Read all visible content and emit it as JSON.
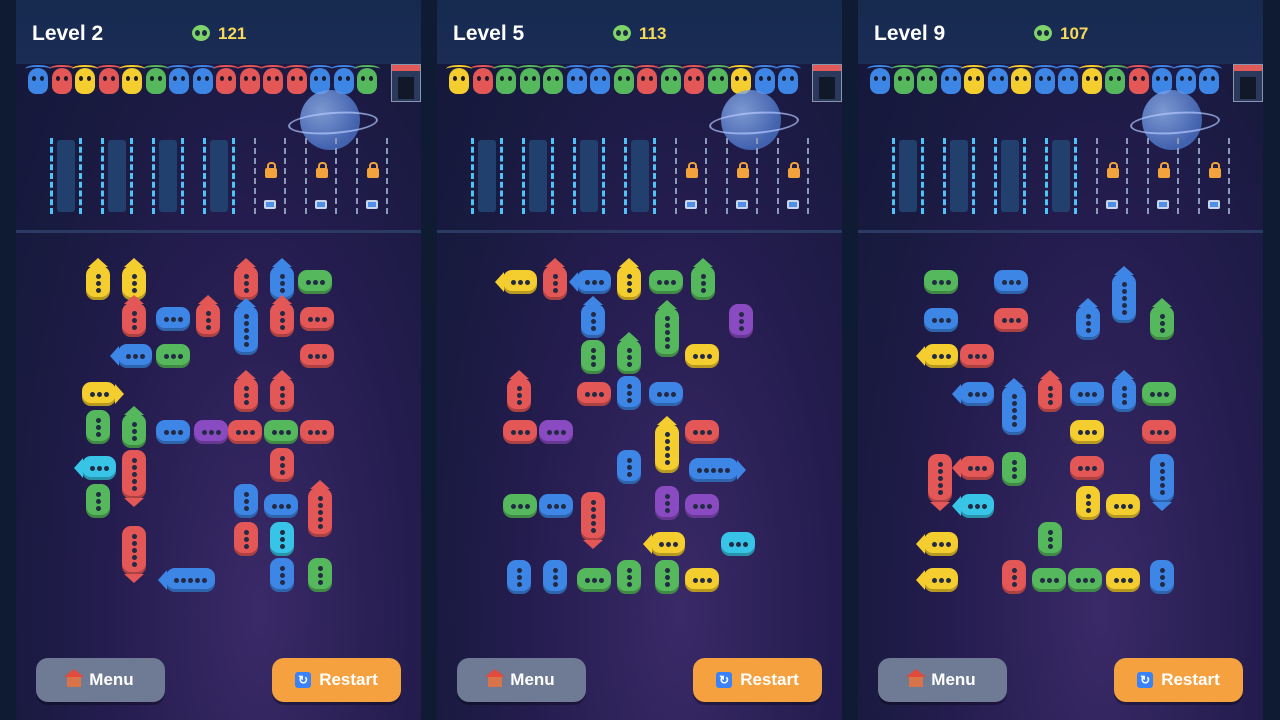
{
  "colors": {
    "red": "#e45757",
    "blue": "#3e86e6",
    "yellow": "#f4cd2e",
    "green": "#56b85c",
    "purple": "#8a4bc2",
    "cyan": "#38c4e6"
  },
  "buttons": {
    "menu_label": "Menu",
    "restart_label": "Restart",
    "menu_icon": "home-icon",
    "restart_icon": "refresh-icon"
  },
  "panels": [
    {
      "level": "Level 2",
      "score": "121",
      "queue": [
        "blue",
        "red",
        "yellow",
        "red",
        "yellow",
        "green",
        "blue",
        "blue",
        "red",
        "red",
        "red",
        "red",
        "blue",
        "blue",
        "green"
      ],
      "slots_open": 4,
      "slots_locked": 3
    },
    {
      "level": "Level 5",
      "score": "113",
      "queue": [
        "yellow",
        "red",
        "green",
        "green",
        "green",
        "blue",
        "blue",
        "green",
        "red",
        "green",
        "red",
        "green",
        "yellow",
        "blue",
        "blue"
      ],
      "slots_open": 4,
      "slots_locked": 3
    },
    {
      "level": "Level 9",
      "score": "107",
      "queue": [
        "blue",
        "green",
        "green",
        "blue",
        "yellow",
        "blue",
        "yellow",
        "blue",
        "blue",
        "yellow",
        "green",
        "red",
        "blue",
        "blue",
        "blue"
      ],
      "slots_open": 4,
      "slots_locked": 3
    }
  ]
}
